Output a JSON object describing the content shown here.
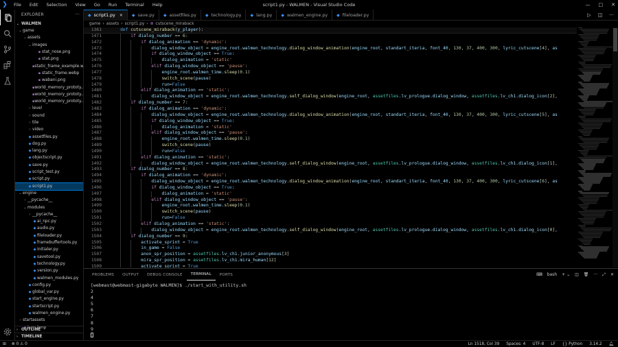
{
  "titlebar": {
    "menu": [
      "File",
      "Edit",
      "Selection",
      "View",
      "Go",
      "Run",
      "Terminal",
      "Help"
    ],
    "title": "script1.py - WALMEN - Visual Studio Code"
  },
  "sidebar": {
    "header": "EXPLORER",
    "workspace": "WALMEN",
    "tree": [
      {
        "label": "game",
        "depth": 0,
        "type": "folder",
        "open": true
      },
      {
        "label": "assets",
        "depth": 1,
        "type": "folder",
        "open": true
      },
      {
        "label": "images",
        "depth": 2,
        "type": "folder",
        "open": true
      },
      {
        "label": "stat_nose.png",
        "depth": 3,
        "type": "file"
      },
      {
        "label": "stat.png",
        "depth": 3,
        "type": "file"
      },
      {
        "label": "static_frame_example.w...",
        "depth": 3,
        "type": "file"
      },
      {
        "label": "static_frame.webp",
        "depth": 3,
        "type": "file"
      },
      {
        "label": "wabani.png",
        "depth": 3,
        "type": "file"
      },
      {
        "label": "world_memory_prototy...",
        "depth": 3,
        "type": "file"
      },
      {
        "label": "world_memory_prototy...",
        "depth": 3,
        "type": "file"
      },
      {
        "label": "world_memory_prototy...",
        "depth": 3,
        "type": "file"
      },
      {
        "label": "level",
        "depth": 2,
        "type": "folder",
        "open": false
      },
      {
        "label": "sound",
        "depth": 2,
        "type": "folder",
        "open": false
      },
      {
        "label": "tile",
        "depth": 2,
        "type": "folder",
        "open": false
      },
      {
        "label": "video",
        "depth": 2,
        "type": "folder",
        "open": false
      },
      {
        "label": "assetfiles.py",
        "depth": 1,
        "type": "py"
      },
      {
        "label": "dog.py",
        "depth": 1,
        "type": "py"
      },
      {
        "label": "lang.py",
        "depth": 1,
        "type": "py"
      },
      {
        "label": "objectscript.py",
        "depth": 1,
        "type": "py"
      },
      {
        "label": "save.py",
        "depth": 1,
        "type": "py"
      },
      {
        "label": "script_test.py",
        "depth": 1,
        "type": "py"
      },
      {
        "label": "script.py",
        "depth": 1,
        "type": "py"
      },
      {
        "label": "script1.py",
        "depth": 1,
        "type": "py",
        "selected": true
      },
      {
        "label": "engine",
        "depth": 0,
        "type": "folder",
        "open": true
      },
      {
        "label": "__pycache__",
        "depth": 1,
        "type": "folder",
        "open": false
      },
      {
        "label": "modules",
        "depth": 1,
        "type": "folder",
        "open": true
      },
      {
        "label": "__pycache__",
        "depth": 2,
        "type": "folder",
        "open": false
      },
      {
        "label": "ai_npc.py",
        "depth": 2,
        "type": "py"
      },
      {
        "label": "audio.py",
        "depth": 2,
        "type": "py"
      },
      {
        "label": "fileloader.py",
        "depth": 2,
        "type": "py"
      },
      {
        "label": "framebuffertools.py",
        "depth": 2,
        "type": "py"
      },
      {
        "label": "initialer.py",
        "depth": 2,
        "type": "py"
      },
      {
        "label": "savetool.py",
        "depth": 2,
        "type": "py"
      },
      {
        "label": "technology.py",
        "depth": 2,
        "type": "py"
      },
      {
        "label": "version.py",
        "depth": 2,
        "type": "py"
      },
      {
        "label": "walmen_modules.py",
        "depth": 2,
        "type": "py"
      },
      {
        "label": "config.py",
        "depth": 1,
        "type": "py"
      },
      {
        "label": "global_var.py",
        "depth": 1,
        "type": "py"
      },
      {
        "label": "start_engine.py",
        "depth": 1,
        "type": "py"
      },
      {
        "label": "startscript.py",
        "depth": 1,
        "type": "py"
      },
      {
        "label": "walmen_engine.py",
        "depth": 1,
        "type": "py"
      },
      {
        "label": "startassets",
        "depth": 0,
        "type": "folder",
        "open": false
      },
      {
        "label": "icon.bmp",
        "depth": 0,
        "type": "file"
      }
    ],
    "outline": "OUTLINE",
    "timeline": "TIMELINE"
  },
  "tabs": [
    {
      "label": "script1.py",
      "active": true
    },
    {
      "label": "save.py"
    },
    {
      "label": "assetfiles.py"
    },
    {
      "label": "technology.py"
    },
    {
      "label": "lang.py"
    },
    {
      "label": "walmen_engine.py"
    },
    {
      "label": "fileloader.py"
    }
  ],
  "breadcrumb": [
    "game",
    "assets",
    "script1.py",
    "cutscene_miraback"
  ],
  "editor": {
    "sticky": {
      "num": "1361",
      "text": "def cutscene_miraback(y_player):"
    },
    "lines": [
      {
        "num": "1471",
        "indent": 2,
        "text": "if dialog_number == 6:"
      },
      {
        "num": "1472",
        "indent": 3,
        "text": "if dialog_animation == 'dynamic':"
      },
      {
        "num": "1473",
        "indent": 4,
        "text": "dialog_window_object = engine_root.walmen_technology.dialog_window_animation(engine_root, standart_iteria, font_40, 130, 37, 400, 300, lyric_cutscene[4], as"
      },
      {
        "num": "1474",
        "indent": 4,
        "text": "if dialog_window_object == True:"
      },
      {
        "num": "1475",
        "indent": 5,
        "text": "dialog_animation = 'static'"
      },
      {
        "num": "1476",
        "indent": 4,
        "text": "elif dialog_window_object == 'pause':"
      },
      {
        "num": "1477",
        "indent": 5,
        "text": "engine_root.walmen_time.sleep(0.1)"
      },
      {
        "num": "1478",
        "indent": 5,
        "text": "switch_scene(pause)"
      },
      {
        "num": "1479",
        "indent": 5,
        "text": "run=False"
      },
      {
        "num": "1480",
        "indent": 3,
        "text": "elif dialog_animation == 'static':"
      },
      {
        "num": "1481",
        "indent": 4,
        "text": "dialog_window_object = engine_root.walmen_technology.self_dialog_window(engine_root, assetfiles.lv_prologue.dialog_window, assetfiles.lv_ch1.dialog_icon[2],"
      },
      {
        "num": "1482",
        "indent": 2,
        "text": "if dialog_number == 7:"
      },
      {
        "num": "1483",
        "indent": 3,
        "text": "if dialog_animation == 'dynamic':"
      },
      {
        "num": "1484",
        "indent": 4,
        "text": "dialog_window_object = engine_root.walmen_technology.dialog_window_animation(engine_root, standart_iteria, font_40, 130, 37, 400, 300, lyric_cutscene[5], as"
      },
      {
        "num": "1485",
        "indent": 4,
        "text": "if dialog_window_object == True:"
      },
      {
        "num": "1486",
        "indent": 5,
        "text": "dialog_animation = 'static'"
      },
      {
        "num": "1487",
        "indent": 4,
        "text": "elif dialog_window_object == 'pause':"
      },
      {
        "num": "1488",
        "indent": 5,
        "text": "engine_root.walmen_time.sleep(0.1)"
      },
      {
        "num": "1489",
        "indent": 5,
        "text": "switch_scene(pause)"
      },
      {
        "num": "1490",
        "indent": 5,
        "text": "run=False"
      },
      {
        "num": "1491",
        "indent": 3,
        "text": "elif dialog_animation == 'static':"
      },
      {
        "num": "1492",
        "indent": 4,
        "text": "dialog_window_object = engine_root.walmen_technology.self_dialog_window(engine_root, assetfiles.lv_prologue.dialog_window, assetfiles.lv_ch1.dialog_icon[1],"
      },
      {
        "num": "1493",
        "indent": 2,
        "text": "if dialog_number == 8:"
      },
      {
        "num": "1494",
        "indent": 3,
        "text": "if dialog_animation == 'dynamic':"
      },
      {
        "num": "1495",
        "indent": 4,
        "text": "dialog_window_object = engine_root.walmen_technology.dialog_window_animation(engine_root, standart_iteria, font_40, 130, 37, 400, 300, lyric_cutscene[6], as"
      },
      {
        "num": "1496",
        "indent": 4,
        "text": "if dialog_window_object == True:"
      },
      {
        "num": "1497",
        "indent": 5,
        "text": "dialog_animation = 'static'"
      },
      {
        "num": "1498",
        "indent": 4,
        "text": "elif dialog_window_object == 'pause':"
      },
      {
        "num": "1499",
        "indent": 5,
        "text": "engine_root.walmen_time.sleep(0.1)"
      },
      {
        "num": "1500",
        "indent": 5,
        "text": "switch_scene(pause)"
      },
      {
        "num": "1501",
        "indent": 5,
        "text": "run=False"
      },
      {
        "num": "1502",
        "indent": 3,
        "text": "elif dialog_animation == 'static':"
      },
      {
        "num": "1503",
        "indent": 4,
        "text": "dialog_window_object = engine_root.walmen_technology.self_dialog_window(engine_root, assetfiles.lv_prologue.dialog_window, assetfiles.lv_ch1.dialog_icon[0],"
      },
      {
        "num": "1504",
        "indent": 2,
        "text": "if dialog_number == 9:"
      },
      {
        "num": "1505",
        "indent": 3,
        "text": "activate_sprint = True"
      },
      {
        "num": "1506",
        "indent": 3,
        "text": "in_game = False"
      },
      {
        "num": "1507",
        "indent": 3,
        "text": "anon_spr_position = assetfiles.lv_ch1.junior_anonymous[3]"
      },
      {
        "num": "1508",
        "indent": 3,
        "text": "mira_spr_position = assetfiles.lv_ch1.mira_human[12]"
      },
      {
        "num": "1509",
        "indent": 3,
        "text": "activate_sprint = True"
      }
    ]
  },
  "panel": {
    "tabs": [
      "PROBLEMS",
      "OUTPUT",
      "DEBUG CONSOLE",
      "TERMINAL",
      "PORTS"
    ],
    "active_tab": "TERMINAL",
    "shell": "bash",
    "prompt": "[webmast@webmast-gigabyte WALMEN]$ ./start_with_utility.sh",
    "output": [
      "2",
      "4",
      "5",
      "6",
      "7",
      "8",
      "9"
    ]
  },
  "statusbar": {
    "errors": "0",
    "warnings": "0",
    "position": "Ln 1518, Col 39",
    "spaces": "Spaces: 4",
    "encoding": "UTF-8",
    "eol": "LF",
    "language": "Python",
    "version": "3.14.2"
  },
  "colors": {
    "accent": "#0078d4",
    "keyword": "#569cd6",
    "control": "#c586c0",
    "string": "#ce9178",
    "function": "#dcdcaa",
    "class": "#4ec9b0"
  }
}
